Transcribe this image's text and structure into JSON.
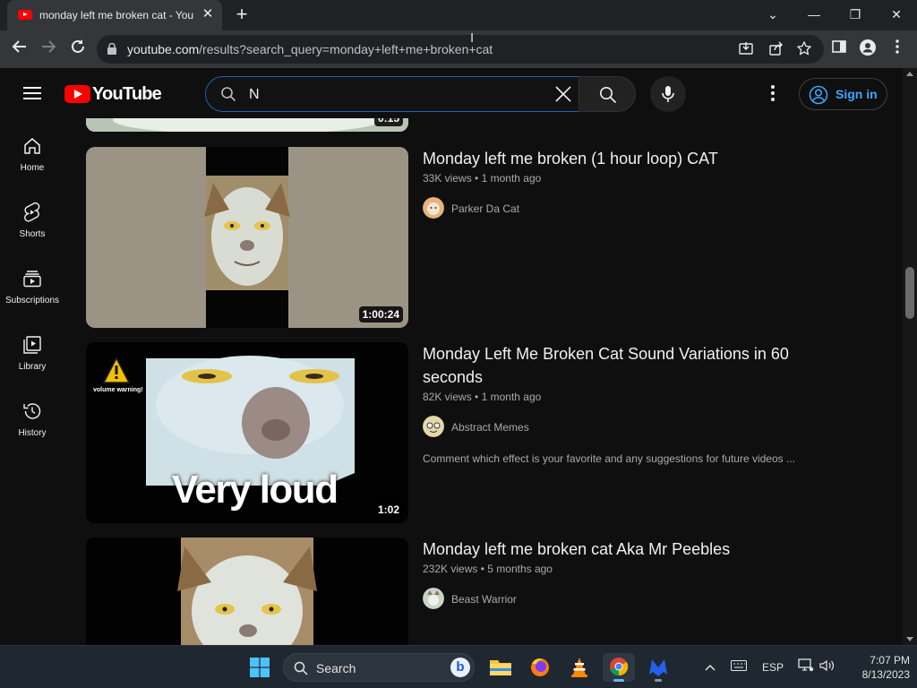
{
  "browser": {
    "tab_title": "monday left me broken cat - You",
    "tab_close_glyph": "✕",
    "new_tab_glyph": "+",
    "url_host": "youtube.com",
    "url_path": "/results?search_query=monday+left+me+broken+cat",
    "window_controls": [
      "⌄",
      "—",
      "❐",
      "✕"
    ]
  },
  "youtube": {
    "logo_text": "YouTube",
    "search_value": "N",
    "signin_label": "Sign in",
    "sidebar": [
      {
        "label": "Home",
        "icon": "home-icon"
      },
      {
        "label": "Shorts",
        "icon": "shorts-icon"
      },
      {
        "label": "Subscriptions",
        "icon": "subscriptions-icon"
      },
      {
        "label": "Library",
        "icon": "library-icon"
      },
      {
        "label": "History",
        "icon": "history-icon"
      }
    ]
  },
  "results": {
    "partial_top": {
      "duration": "0:15"
    },
    "videos": [
      {
        "title": "Monday left me broken (1 hour loop) CAT",
        "views": "33K views",
        "age": "1 month ago",
        "channel": "Parker Da Cat",
        "duration": "1:00:24",
        "description": ""
      },
      {
        "title": "Monday Left Me Broken Cat Sound Variations in 60 seconds",
        "views": "82K views",
        "age": "1 month ago",
        "channel": "Abstract Memes",
        "duration": "1:02",
        "description": "Comment which effect is your favorite and any suggestions for future videos ...",
        "thumb_text": "Very loud",
        "thumb_warning": "volume warning!"
      },
      {
        "title": "Monday left me broken cat Aka Mr Peebles",
        "views": "232K views",
        "age": "5 months ago",
        "channel": "Beast Warrior",
        "duration": "",
        "description": ""
      }
    ],
    "meta_separator": "•"
  },
  "taskbar": {
    "search_label": "Search",
    "language": "ESP",
    "time": "7:07 PM",
    "date": "8/13/2023"
  },
  "colors": {
    "background": "#0f0f0f",
    "accent_blue": "#3ea6ff",
    "youtube_red": "#ff0000",
    "text_secondary": "#aaaaaa"
  }
}
